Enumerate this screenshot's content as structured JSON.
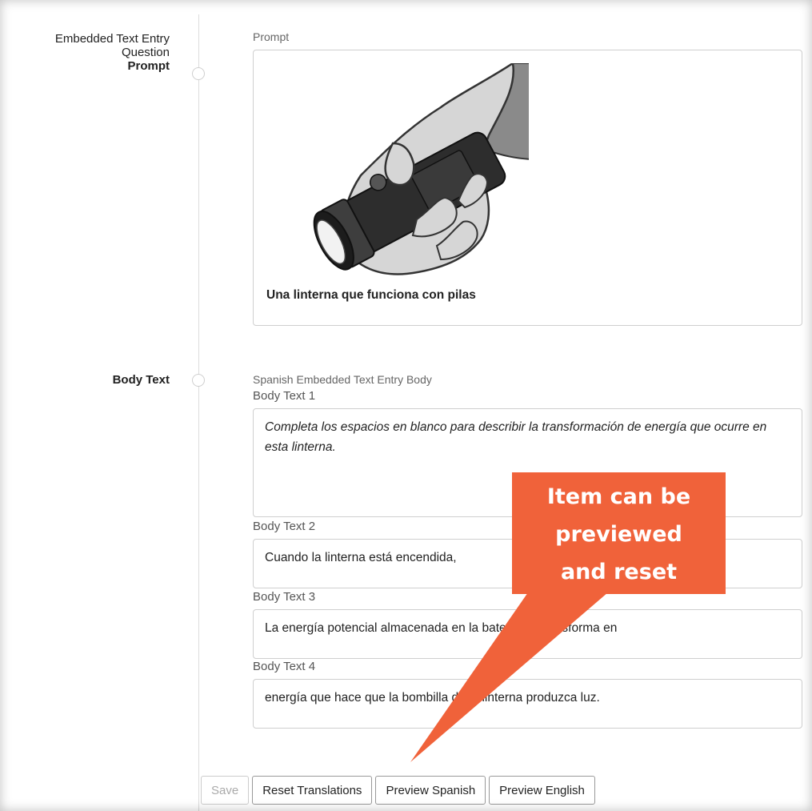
{
  "sections": {
    "prompt": {
      "label_line1": "Embedded Text Entry",
      "label_line2": "Question",
      "label_bold": "Prompt",
      "field_label": "Prompt",
      "image_caption": "Una linterna que funciona con pilas"
    },
    "body": {
      "label_bold": "Body Text",
      "field_label": "Spanish Embedded Text Entry Body",
      "fields": [
        {
          "label": "Body Text 1",
          "value": "Completa los espacios en blanco para describir la transformación de energía que ocurre en esta linterna."
        },
        {
          "label": "Body Text 2",
          "value": "Cuando la linterna está encendida,"
        },
        {
          "label": "Body Text 3",
          "value": "La energía potencial almacenada en la batería se transforma en"
        },
        {
          "label": "Body Text 4",
          "value": "energía que hace que la bombilla de la linterna produzca luz."
        }
      ]
    }
  },
  "buttons": {
    "save": "Save",
    "reset": "Reset Translations",
    "preview_spanish": "Preview Spanish",
    "preview_english": "Preview English"
  },
  "callout": {
    "line1": "Item can be",
    "line2": "previewed",
    "line3": "and reset",
    "color": "#f0623a"
  }
}
